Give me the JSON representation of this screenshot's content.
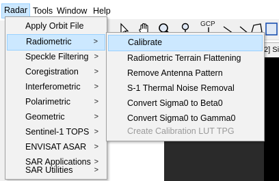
{
  "menubar": {
    "items": [
      "Radar",
      "Tools",
      "Window",
      "Help"
    ]
  },
  "toolbar": {
    "gcp_label": "GCP",
    "icons": [
      "select-tool-icon",
      "pan-hand-icon",
      "zoom-icon",
      "pin-icon",
      "gcp-icon",
      "range-icon",
      "cross-icon",
      "polygon-icon",
      "rectangle-icon"
    ]
  },
  "right_panel": {
    "text": "2] Si"
  },
  "radar_menu": {
    "items": [
      {
        "label": "Apply Orbit File",
        "arrow": ""
      },
      {
        "label": "Radiometric",
        "arrow": ">"
      },
      {
        "label": "Speckle Filtering",
        "arrow": ">"
      },
      {
        "label": "Coregistration",
        "arrow": ">"
      },
      {
        "label": "Interferometric",
        "arrow": ">"
      },
      {
        "label": "Polarimetric",
        "arrow": ">"
      },
      {
        "label": "Geometric",
        "arrow": ">"
      },
      {
        "label": "Sentinel-1 TOPS",
        "arrow": ">"
      },
      {
        "label": "ENVISAT ASAR",
        "arrow": ">"
      },
      {
        "label": "SAR Applications",
        "arrow": ">"
      },
      {
        "label": "SAR Utilities",
        "arrow": ">"
      }
    ]
  },
  "radiometric_menu": {
    "items": [
      {
        "label": "Calibrate"
      },
      {
        "label": "Radiometric Terrain Flattening"
      },
      {
        "label": "Remove Antenna Pattern"
      },
      {
        "label": "S-1 Thermal Noise Removal"
      },
      {
        "label": "Convert Sigma0 to Beta0"
      },
      {
        "label": "Convert Sigma0 to Gamma0"
      },
      {
        "label": "Create Calibration LUT TPG"
      }
    ]
  },
  "colors": {
    "highlight": "#cce8ff",
    "highlight_border": "#99d1ff",
    "menu_bg": "#f2f2f2",
    "disabled_text": "#9a9a9a",
    "dark_area": "#2a2a2a"
  }
}
